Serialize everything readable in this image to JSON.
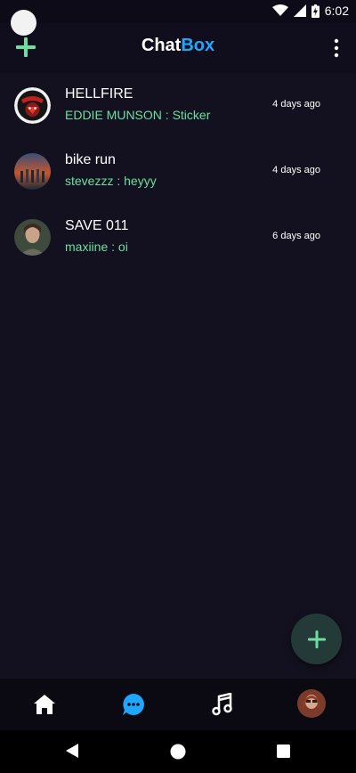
{
  "status_bar": {
    "time": "6:02"
  },
  "app_bar": {
    "title_part1": "Chat",
    "title_part2": "Box",
    "accent_color": "#1ea7ff"
  },
  "chats": [
    {
      "name": "HELLFIRE",
      "preview": "EDDIE MUNSON : Sticker",
      "time": "4 days ago",
      "avatar": "hellfire-club-logo"
    },
    {
      "name": "bike run",
      "preview": "stevezzz : heyyy",
      "time": "4 days ago",
      "avatar": "group-photo"
    },
    {
      "name": "SAVE 011",
      "preview": "maxiine : oi",
      "time": "6 days ago",
      "avatar": "person-photo"
    }
  ],
  "bottom_nav": {
    "items": [
      "home-icon",
      "chat-icon",
      "music-icon",
      "profile-avatar"
    ],
    "active": "chat-icon"
  },
  "colors": {
    "background": "#13111f",
    "preview_text": "#69e0a0"
  }
}
